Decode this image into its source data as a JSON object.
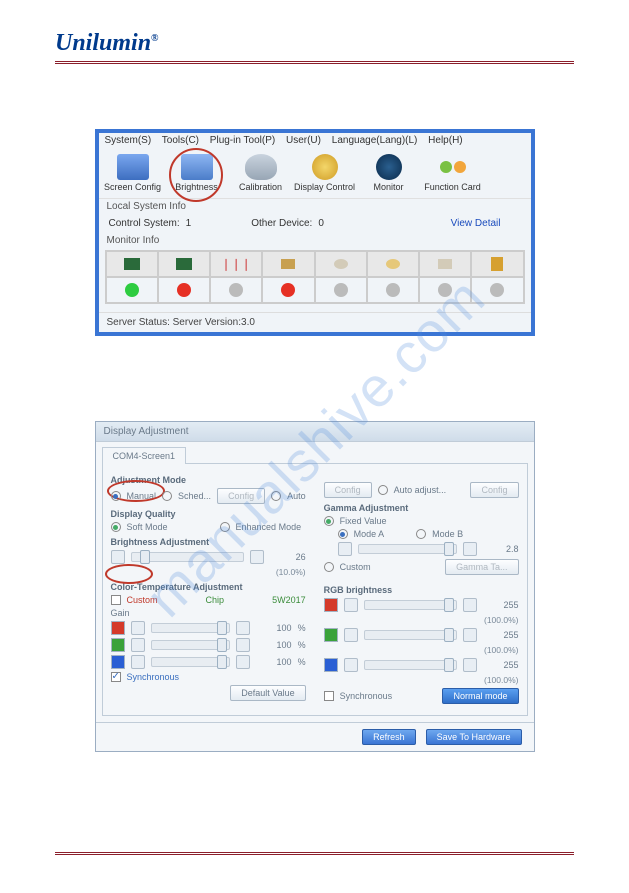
{
  "brand": "Unilumin",
  "watermark": "manualshive.com",
  "window1": {
    "menu": [
      "System(S)",
      "Tools(C)",
      "Plug-in Tool(P)",
      "User(U)",
      "Language(Lang)(L)",
      "Help(H)"
    ],
    "toolbar": [
      {
        "label": "Screen Config",
        "icon": "screen-config-icon"
      },
      {
        "label": "Brightness",
        "icon": "brightness-icon",
        "highlighted": true
      },
      {
        "label": "Calibration",
        "icon": "calibration-icon"
      },
      {
        "label": "Display Control",
        "icon": "display-control-icon"
      },
      {
        "label": "Monitor",
        "icon": "monitor-icon"
      },
      {
        "label": "Function Card",
        "icon": "function-card-icon"
      }
    ],
    "local_system_info": "Local System Info",
    "control_system_label": "Control System:",
    "control_system_value": "1",
    "other_device_label": "Other Device:",
    "other_device_value": "0",
    "view_detail": "View Detail",
    "monitor_info": "Monitor Info",
    "monitor_status": [
      "green",
      "red",
      "gray",
      "red",
      "gray",
      "gray",
      "gray",
      "gray"
    ],
    "server_status": "Server Status:  Server Version:3.0"
  },
  "window2": {
    "title": "Display Adjustment",
    "tab": "COM4-Screen1",
    "adjustment_mode": {
      "label": "Adjustment Mode",
      "options": [
        "Manual",
        "Sched...",
        "Auto",
        "Auto adjust..."
      ],
      "config": "Config",
      "selected": "Manual"
    },
    "display_quality": {
      "label": "Display Quality",
      "options": [
        "Soft Mode",
        "Enhanced Mode"
      ],
      "selected": "Soft Mode"
    },
    "brightness_adjustment": {
      "label": "Brightness Adjustment",
      "value": "26",
      "percent": "(10.0%)"
    },
    "color_temp": {
      "label": "Color-Temperature Adjustment",
      "custom": "Custom",
      "chip": "Chip",
      "chip_value": "5W2017",
      "gain": "Gain",
      "channels": [
        {
          "name": "R",
          "value": "100"
        },
        {
          "name": "G",
          "value": "100"
        },
        {
          "name": "B",
          "value": "100"
        }
      ],
      "sync": "Synchronous",
      "default_btn": "Default Value"
    },
    "gamma": {
      "label": "Gamma Adjustment",
      "fixed": "Fixed Value",
      "modes": [
        "Mode A",
        "Mode B"
      ],
      "value": "2.8",
      "custom": "Custom",
      "gamma_btn": "Gamma Ta..."
    },
    "rgb_brightness": {
      "label": "RGB brightness",
      "channels": [
        {
          "name": "R",
          "value": "255",
          "percent": "(100.0%)"
        },
        {
          "name": "G",
          "value": "255",
          "percent": "(100.0%)"
        },
        {
          "name": "B",
          "value": "255",
          "percent": "(100.0%)"
        }
      ],
      "sync": "Synchronous",
      "mode_btn": "Normal mode"
    },
    "refresh": "Refresh",
    "save": "Save To Hardware"
  }
}
